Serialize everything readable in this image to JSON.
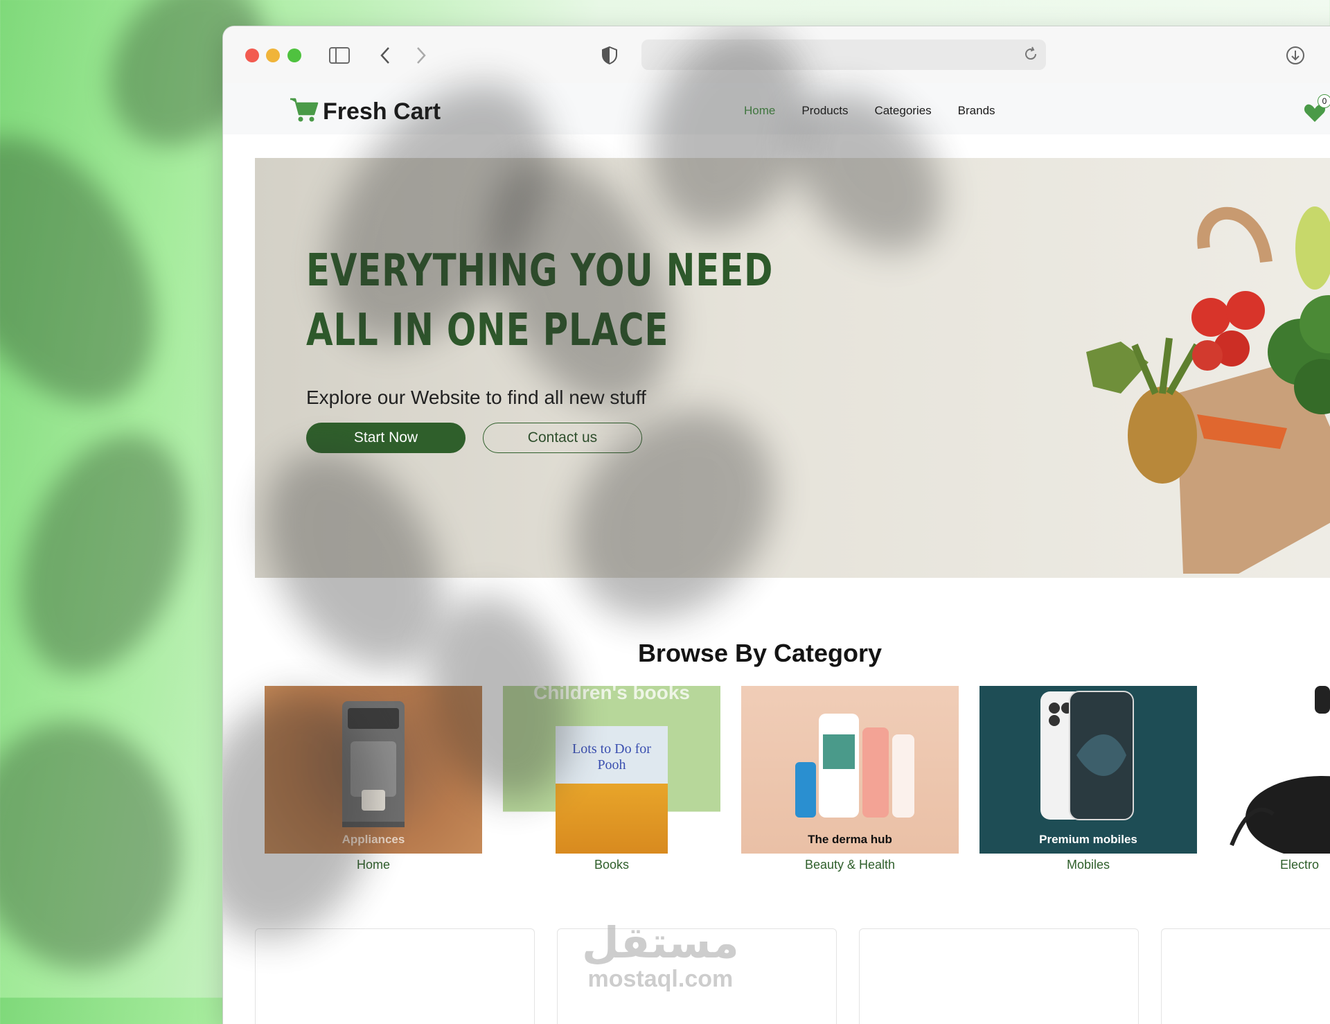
{
  "browser": {
    "traffic_lights": [
      "#f25b50",
      "#f0b43a",
      "#4fc23f"
    ],
    "icons": [
      "sidebar-icon",
      "back-icon",
      "forward-icon",
      "shield-icon",
      "reload-icon",
      "download-icon"
    ]
  },
  "nav": {
    "brand": "Fresh Cart",
    "links": [
      "Home",
      "Products",
      "Categories",
      "Brands"
    ],
    "active": "Home",
    "wishlist_count": "0"
  },
  "hero": {
    "title_line1": "EVERYTHING YOU NEED",
    "title_line2": "ALL IN ONE PLACE",
    "subtitle": "Explore our Website to find all new stuff",
    "primary_button": "Start Now",
    "secondary_button": "Contact us"
  },
  "categories": {
    "heading": "Browse By Category",
    "items": [
      {
        "label": "Home",
        "image_caption": "Appliances"
      },
      {
        "label": "Books",
        "image_caption": "Children's books",
        "book_title": "Lots to Do for Pooh"
      },
      {
        "label": "Beauty & Health",
        "image_caption": "The derma hub"
      },
      {
        "label": "Mobiles",
        "image_caption": "Premium mobiles"
      },
      {
        "label": "Electro"
      }
    ]
  },
  "watermark": {
    "arabic": "مستقل",
    "latin": "mostaql.com"
  },
  "colors": {
    "accent_green": "#4a9a48",
    "dark_green": "#2f5f2b"
  }
}
